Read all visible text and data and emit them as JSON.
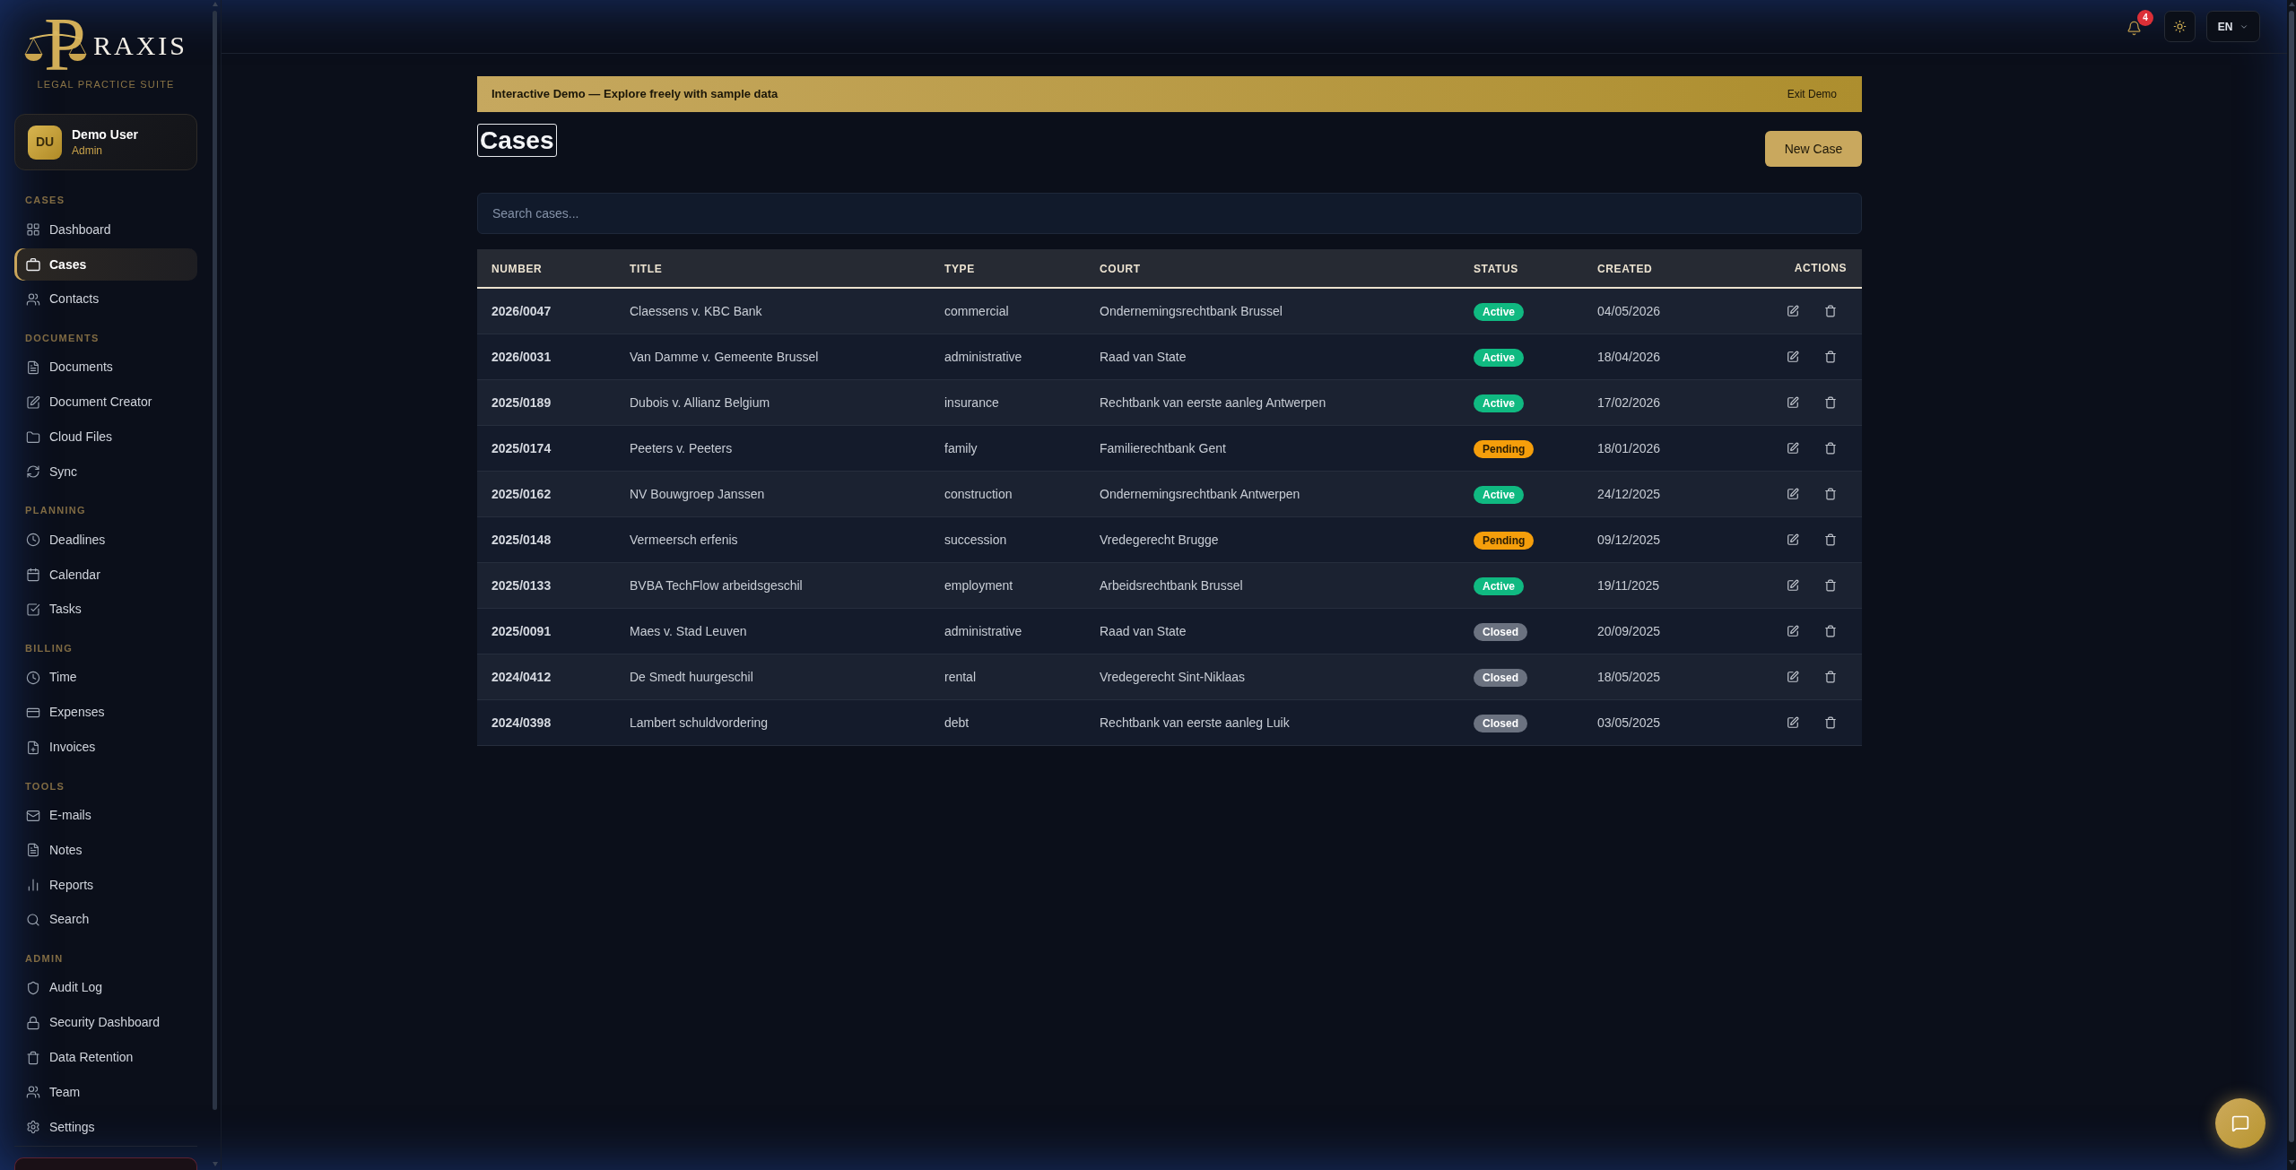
{
  "sidebar": {
    "logo": {
      "initial": "P",
      "name": "RAXIS",
      "tagline": "LEGAL PRACTICE SUITE"
    },
    "user": {
      "initials": "DU",
      "name": "Demo User",
      "role": "Admin"
    },
    "sections": [
      {
        "title": "CASES",
        "items": [
          {
            "label": "Dashboard",
            "selected": false
          },
          {
            "label": "Cases",
            "selected": true
          },
          {
            "label": "Contacts",
            "selected": false
          }
        ]
      },
      {
        "title": "DOCUMENTS",
        "items": [
          {
            "label": "Documents",
            "selected": false
          },
          {
            "label": "Document Creator",
            "selected": false
          },
          {
            "label": "Cloud Files",
            "selected": false
          },
          {
            "label": "Sync",
            "selected": false
          }
        ]
      },
      {
        "title": "PLANNING",
        "items": [
          {
            "label": "Deadlines",
            "selected": false
          },
          {
            "label": "Calendar",
            "selected": false
          },
          {
            "label": "Tasks",
            "selected": false
          }
        ]
      },
      {
        "title": "BILLING",
        "items": [
          {
            "label": "Time",
            "selected": false
          },
          {
            "label": "Expenses",
            "selected": false
          },
          {
            "label": "Invoices",
            "selected": false
          }
        ]
      },
      {
        "title": "TOOLS",
        "items": [
          {
            "label": "E-mails",
            "selected": false
          },
          {
            "label": "Notes",
            "selected": false
          },
          {
            "label": "Reports",
            "selected": false
          },
          {
            "label": "Search",
            "selected": false
          }
        ]
      },
      {
        "title": "ADMIN",
        "items": [
          {
            "label": "Audit Log",
            "selected": false
          },
          {
            "label": "Security Dashboard",
            "selected": false
          },
          {
            "label": "Data Retention",
            "selected": false
          },
          {
            "label": "Team",
            "selected": false
          },
          {
            "label": "Settings",
            "selected": false
          }
        ]
      }
    ]
  },
  "topbar": {
    "notification_count": "4",
    "language": "EN"
  },
  "banner": {
    "text": "Interactive Demo — Explore freely with sample data",
    "action": "Exit Demo"
  },
  "page": {
    "title": {
      "text": "Cases",
      "focused": true
    },
    "new_button": "New Case"
  },
  "search": {
    "placeholder": "Search cases..."
  },
  "table": {
    "columns": [
      "NUMBER",
      "TITLE",
      "TYPE",
      "COURT",
      "STATUS",
      "CREATED",
      "ACTIONS"
    ],
    "rows": [
      {
        "number": "2026/0047",
        "title": "Claessens v. KBC Bank",
        "type": "commercial",
        "court": "Ondernemingsrechtbank Brussel",
        "status": {
          "label": "Active",
          "color": "#10b981"
        },
        "created": "04/05/2026"
      },
      {
        "number": "2026/0031",
        "title": "Van Damme v. Gemeente Brussel",
        "type": "administrative",
        "court": "Raad van State",
        "status": {
          "label": "Active",
          "color": "#10b981"
        },
        "created": "18/04/2026"
      },
      {
        "number": "2025/0189",
        "title": "Dubois v. Allianz Belgium",
        "type": "insurance",
        "court": "Rechtbank van eerste aanleg Antwerpen",
        "status": {
          "label": "Active",
          "color": "#10b981"
        },
        "created": "17/02/2026"
      },
      {
        "number": "2025/0174",
        "title": "Peeters v. Peeters",
        "type": "family",
        "court": "Familierechtbank Gent",
        "status": {
          "label": "Pending",
          "color": "#f59e0b"
        },
        "created": "18/01/2026"
      },
      {
        "number": "2025/0162",
        "title": "NV Bouwgroep Janssen",
        "type": "construction",
        "court": "Ondernemingsrechtbank Antwerpen",
        "status": {
          "label": "Active",
          "color": "#10b981"
        },
        "created": "24/12/2025"
      },
      {
        "number": "2025/0148",
        "title": "Vermeersch erfenis",
        "type": "succession",
        "court": "Vredegerecht Brugge",
        "status": {
          "label": "Pending",
          "color": "#f59e0b"
        },
        "created": "09/12/2025"
      },
      {
        "number": "2025/0133",
        "title": "BVBA TechFlow arbeidsgeschil",
        "type": "employment",
        "court": "Arbeidsrechtbank Brussel",
        "status": {
          "label": "Active",
          "color": "#10b981"
        },
        "created": "19/11/2025"
      },
      {
        "number": "2025/0091",
        "title": "Maes v. Stad Leuven",
        "type": "administrative",
        "court": "Raad van State",
        "status": {
          "label": "Closed",
          "color": "#6b7280"
        },
        "created": "20/09/2025"
      },
      {
        "number": "2024/0412",
        "title": "De Smedt huurgeschil",
        "type": "rental",
        "court": "Vredegerecht Sint-Niklaas",
        "status": {
          "label": "Closed",
          "color": "#6b7280"
        },
        "created": "18/05/2025"
      },
      {
        "number": "2024/0398",
        "title": "Lambert schuldvordering",
        "type": "debt",
        "court": "Rechtbank van eerste aanleg Luik",
        "status": {
          "label": "Closed",
          "color": "#6b7280"
        },
        "created": "03/05/2025"
      }
    ]
  }
}
